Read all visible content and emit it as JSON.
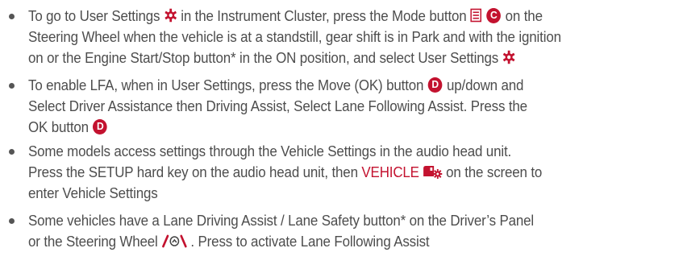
{
  "colors": {
    "text": "#4d4d4d",
    "accent": "#c3122f",
    "bullet": "#555555"
  },
  "icons": {
    "gear": "gear-icon",
    "mode": "mode-button-icon",
    "vehicle": "vehicle-settings-icon",
    "lane": "lane-assist-icon"
  },
  "bullet1": {
    "l1_a": "To go to User Settings",
    "l1_b": "in the Instrument Cluster, press the Mode button",
    "l1_badge": "C",
    "l1_c": "on the",
    "l2": "Steering Wheel when the vehicle is at a standstill, gear shift is in Park and with the ignition",
    "l3": "on or the Engine Start/Stop button* in the ON position, and select User Settings"
  },
  "bullet2": {
    "l1_a": "To enable LFA, when in User Settings, press the Move (OK) button",
    "l1_badge": "D",
    "l1_b": "up/down and",
    "l2": "Select Driver Assistance then Driving Assist, Select Lane Following Assist. Press the",
    "l3": "OK button",
    "l3_badge": "D"
  },
  "bullet3": {
    "l1": "Some models access settings through the Vehicle Settings in the audio head unit.",
    "l2_a": "Press the SETUP hard key on the audio head unit, then",
    "l2_red": "VEHICLE",
    "l2_b": "on the screen to",
    "l3": "enter Vehicle Settings"
  },
  "bullet4": {
    "l1": "Some vehicles have a Lane Driving Assist / Lane Safety button* on the Driver’s Panel",
    "l2_a": "or the Steering Wheel",
    "l2_b": ". Press to activate Lane Following Assist"
  }
}
